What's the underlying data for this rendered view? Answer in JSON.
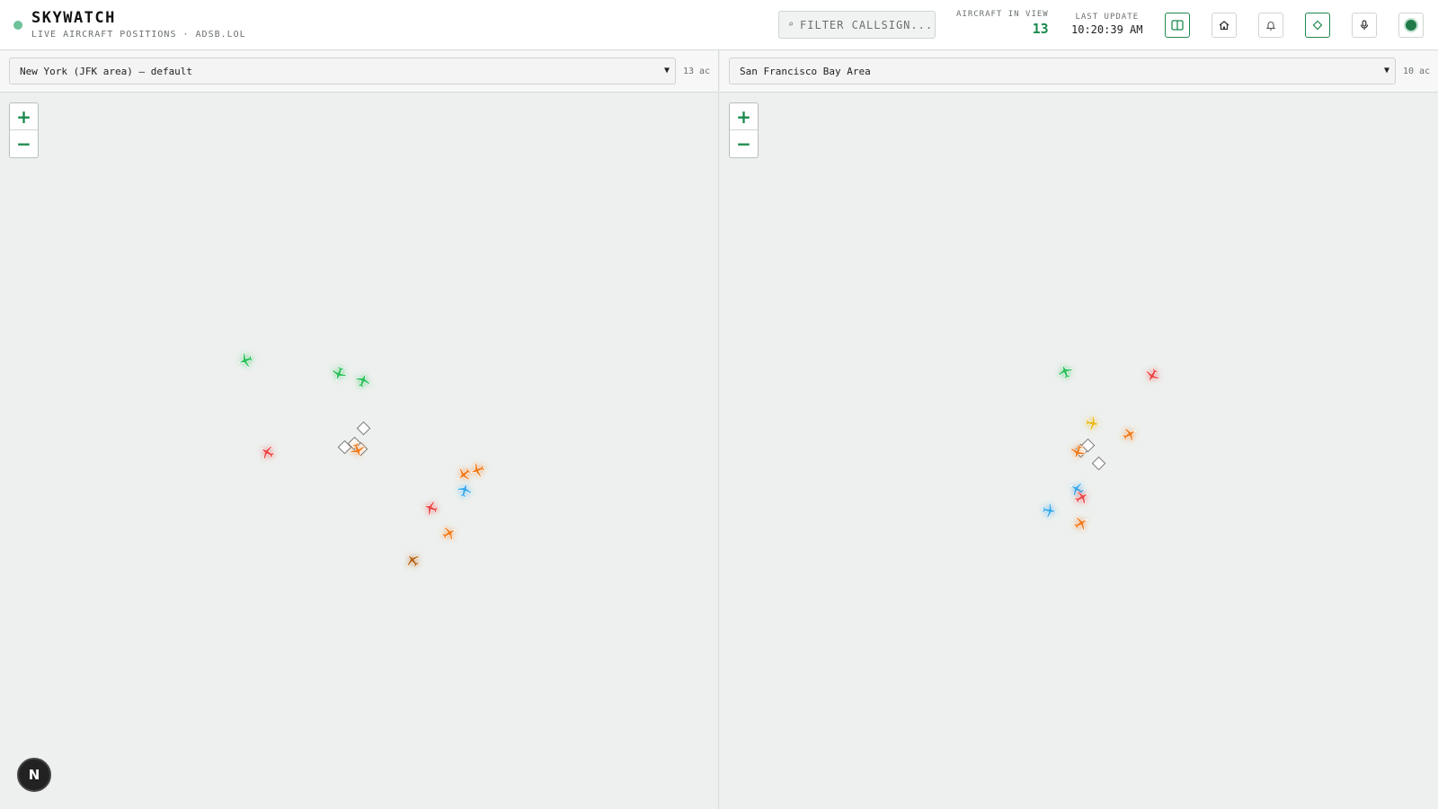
{
  "header": {
    "title": "SKYWATCH",
    "subtitle": "LIVE AIRCRAFT POSITIONS · ADSB.LOL",
    "filter_placeholder": "FILTER CALLSIGN...",
    "aircraft_in_view_label": "AIRCRAFT IN VIEW",
    "aircraft_in_view_count": "13",
    "last_update_label": "LAST UPDATE",
    "last_update_time": "10:20:39 AM",
    "icons": [
      "split-view-icon",
      "home-icon",
      "bell-icon",
      "diamond-icon",
      "mic-icon",
      "status-dot-icon"
    ]
  },
  "panels": [
    {
      "region": "New York (JFK area) — default",
      "count": "13 ac",
      "zoom_in": "+",
      "zoom_out": "−",
      "aircraft": [
        {
          "color": "#2bbf5a",
          "heading": 250
        },
        {
          "color": "#2bbf5a",
          "heading": 200
        },
        {
          "color": "#2bbf5a",
          "heading": 20
        },
        {
          "color": "#e84848",
          "heading": 300
        },
        {
          "color": "#f07c1e",
          "heading": 160
        },
        {
          "color": "#f07c1e",
          "heading": 230
        },
        {
          "color": "#f07c1e",
          "heading": 250
        },
        {
          "color": "#3aa9e8",
          "heading": 15
        },
        {
          "color": "#e84848",
          "heading": 290
        },
        {
          "color": "#f07c1e",
          "heading": 60
        },
        {
          "color": "#b5671a",
          "heading": 320
        }
      ],
      "airports": 4
    },
    {
      "region": "San Francisco Bay Area",
      "count": "10 ac",
      "zoom_in": "+",
      "zoom_out": "−",
      "aircraft": [
        {
          "color": "#2bbf5a",
          "heading": 340
        },
        {
          "color": "#e84848",
          "heading": 210
        },
        {
          "color": "#e8b818",
          "heading": 100
        },
        {
          "color": "#f07c1e",
          "heading": 60
        },
        {
          "color": "#f07c1e",
          "heading": 200
        },
        {
          "color": "#3aa9e8",
          "heading": 300
        },
        {
          "color": "#e84848",
          "heading": 60
        },
        {
          "color": "#3aa9e8",
          "heading": 100
        },
        {
          "color": "#f07c1e",
          "heading": 60
        }
      ],
      "airports": 3
    }
  ],
  "badge": "N"
}
